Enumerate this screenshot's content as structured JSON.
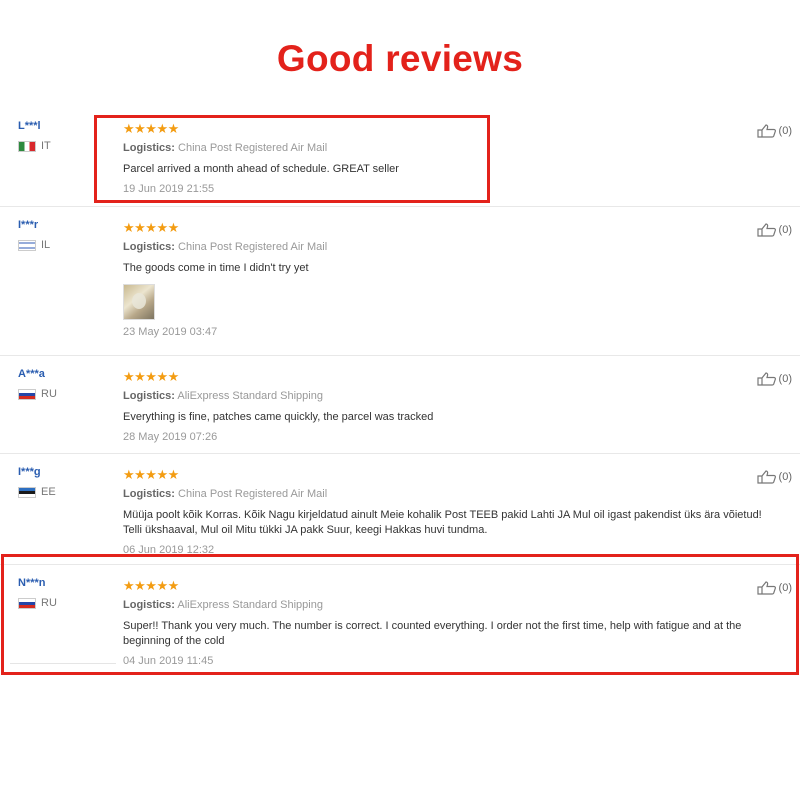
{
  "title": "Good reviews",
  "reviews": [
    {
      "user": "L***l",
      "country": "IT",
      "stars": "★★★★★",
      "logistics_label": "Logistics:",
      "logistics_value": "China Post Registered Air Mail",
      "text": "Parcel arrived a month ahead of schedule. GREAT seller",
      "date": "19 Jun 2019 21:55",
      "likes": "(0)"
    },
    {
      "user": "I***r",
      "country": "IL",
      "stars": "★★★★★",
      "logistics_label": "Logistics:",
      "logistics_value": "China Post Registered Air Mail",
      "text": "The goods come in time I didn't try yet",
      "date": "23 May 2019 03:47",
      "likes": "(0)"
    },
    {
      "user": "A***a",
      "country": "RU",
      "stars": "★★★★★",
      "logistics_label": "Logistics:",
      "logistics_value": "AliExpress Standard Shipping",
      "text": "Everything is fine, patches came quickly, the parcel was tracked",
      "date": "28 May 2019 07:26",
      "likes": "(0)"
    },
    {
      "user": "I***g",
      "country": "EE",
      "stars": "★★★★★",
      "logistics_label": "Logistics:",
      "logistics_value": "China Post Registered Air Mail",
      "text": "Müüja poolt kõik Korras. Kõik Nagu kirjeldatud ainult Meie kohalik Post TEEB pakid Lahti JA Mul oil igast pakendist üks ära võietud! Telli ükshaaval, Mul oil Mitu tükki JA pakk Suur, keegi Hakkas huvi tundma.",
      "date": "06 Jun 2019 12:32",
      "likes": "(0)"
    },
    {
      "user": "N***n",
      "country": "RU",
      "stars": "★★★★★",
      "logistics_label": "Logistics:",
      "logistics_value": "AliExpress Standard Shipping",
      "text": "Super!! Thank you very much. The number is correct. I counted everything. I order not the first time, help with fatigue and at the beginning of the cold",
      "date": "04 Jun 2019 11:45",
      "likes": "(0)"
    }
  ],
  "icons": {
    "like": "thumbs-up-icon"
  },
  "colors": {
    "title": "#e3221b",
    "highlight": "#e3221b",
    "stars": "#f39c12",
    "username": "#2a5db0"
  }
}
